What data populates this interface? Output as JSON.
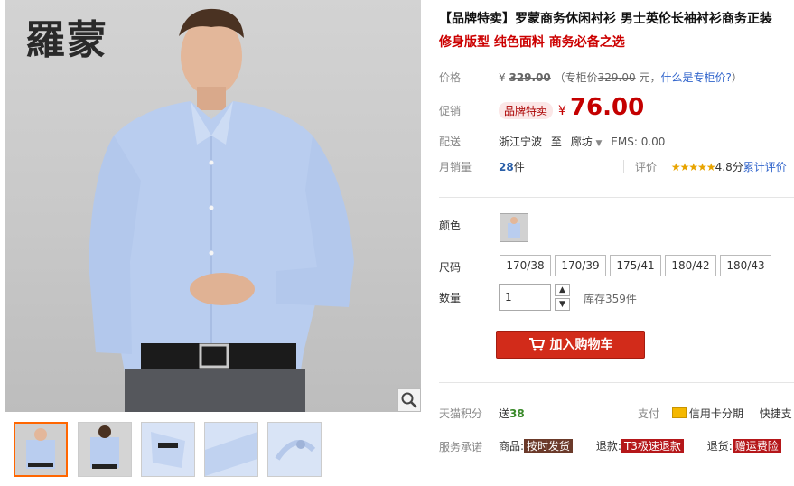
{
  "brand_logo": "羅蒙",
  "title": "【品牌特卖】罗蒙商务休闲衬衫 男士英伦长袖衬衫商务正装",
  "subtitle": "修身版型 纯色面料 商务必备之选",
  "price": {
    "label": "价格",
    "currency": "¥",
    "original": "329.00",
    "counter_prefix": "（专柜价",
    "counter_value": "329.00",
    "counter_unit": "元，",
    "counter_link": "什么是专柜价?",
    "counter_suffix": "）"
  },
  "promo": {
    "label": "促销",
    "badge": "品牌特卖",
    "currency": "¥",
    "price": "76.00"
  },
  "shipping": {
    "label": "配送",
    "from": "浙江宁波",
    "to_word": "至",
    "destination": "廊坊",
    "ems": "EMS: 0.00"
  },
  "sales": {
    "label": "月销量",
    "count": "28",
    "unit": "件",
    "review_label": "评价",
    "stars": "★★★★★",
    "score": "4.8分",
    "review_link": "累计评价"
  },
  "color": {
    "label": "颜色"
  },
  "size": {
    "label": "尺码",
    "options": [
      "170/38",
      "170/39",
      "175/41",
      "180/42",
      "180/43"
    ]
  },
  "quantity": {
    "label": "数量",
    "value": "1",
    "stock": "库存359件"
  },
  "cart_button": "加入购物车",
  "points": {
    "label": "天猫积分",
    "prefix": "送",
    "value": "38"
  },
  "payment": {
    "label": "支付",
    "credit": "信用卡分期",
    "express": "快捷支"
  },
  "service": {
    "label": "服务承诺",
    "goods_prefix": "商品:",
    "goods_tag": "按时发货",
    "refund_prefix": "退款:",
    "refund_tag": "T3极速退款",
    "return_prefix": "退货:",
    "return_tag": "赠运费险"
  },
  "colors": {
    "price_red": "#c40000",
    "cart_red": "#d22b1a",
    "link_blue": "#3366cc",
    "star_gold": "#e8a400"
  }
}
